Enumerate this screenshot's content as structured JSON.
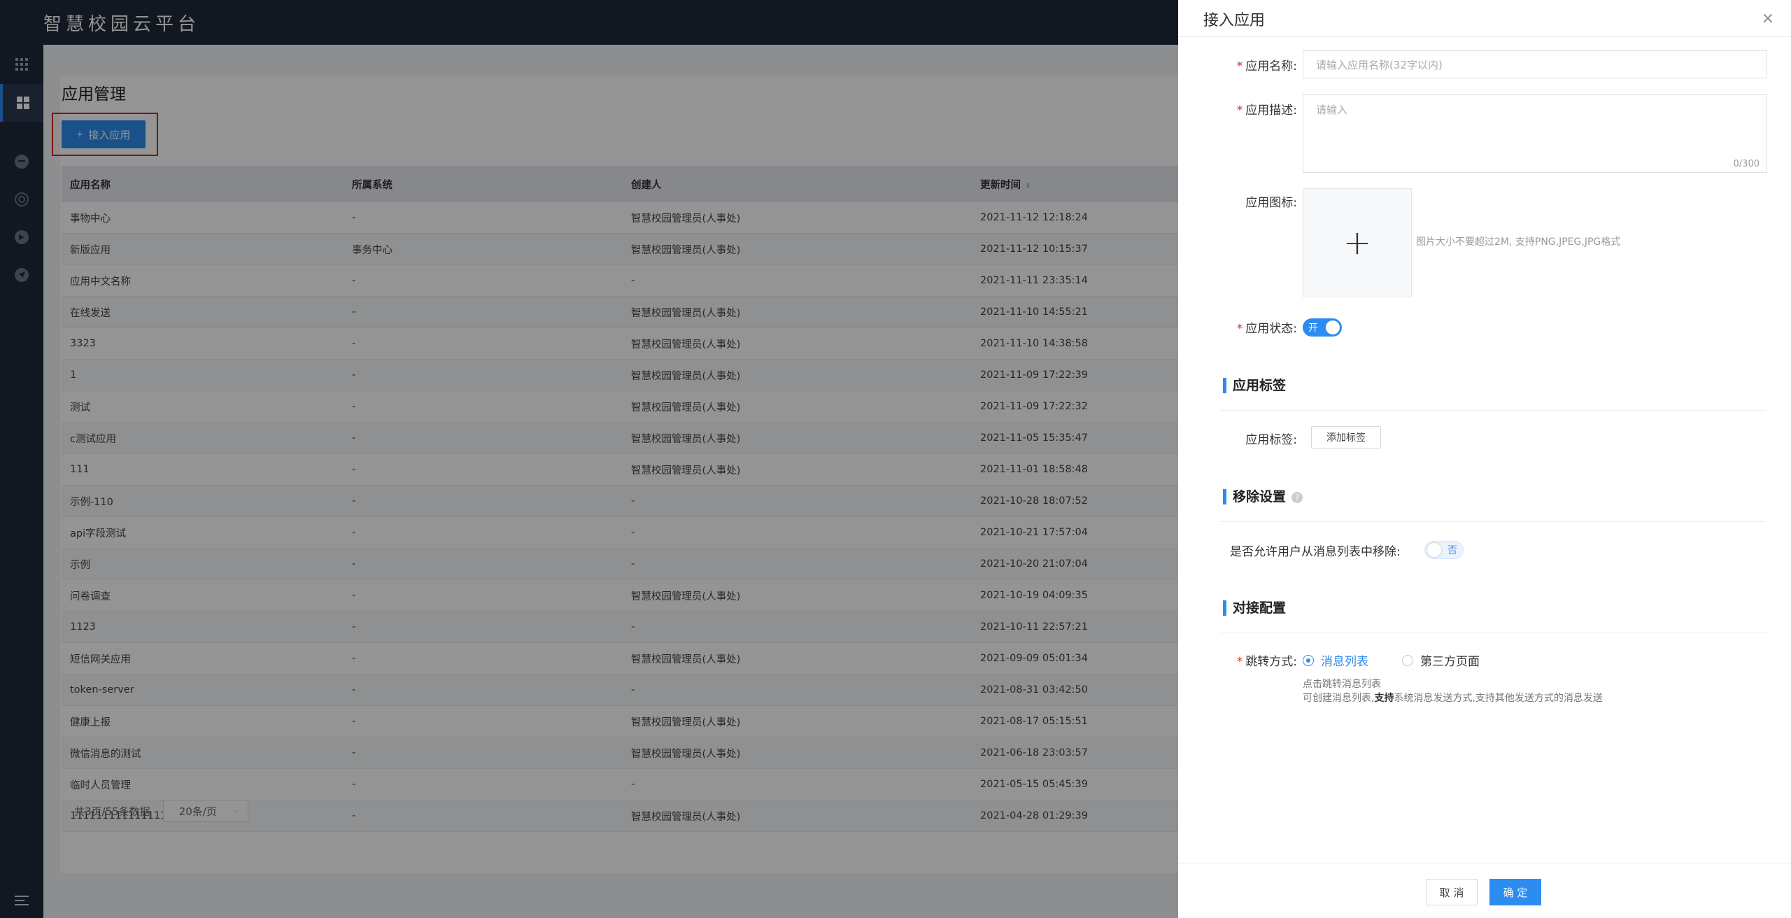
{
  "app": {
    "title": "智慧校园云平台"
  },
  "page": {
    "title": "应用管理",
    "add_button": "接入应用"
  },
  "table": {
    "columns": [
      "应用名称",
      "所属系统",
      "创建人",
      "更新时间"
    ],
    "rows": [
      [
        "事物中心",
        "-",
        "智慧校园管理员(人事处)",
        "2021-11-12 12:18:24"
      ],
      [
        "新版应用",
        "事务中心",
        "智慧校园管理员(人事处)",
        "2021-11-12 10:15:37"
      ],
      [
        "应用中文名称",
        "-",
        "-",
        "2021-11-11 23:35:14"
      ],
      [
        "在线发送",
        "-",
        "智慧校园管理员(人事处)",
        "2021-11-10 14:55:21"
      ],
      [
        "3323",
        "-",
        "智慧校园管理员(人事处)",
        "2021-11-10 14:38:58"
      ],
      [
        "1",
        "-",
        "智慧校园管理员(人事处)",
        "2021-11-09 17:22:39"
      ],
      [
        "测试",
        "-",
        "智慧校园管理员(人事处)",
        "2021-11-09 17:22:32"
      ],
      [
        "c测试应用",
        "-",
        "智慧校园管理员(人事处)",
        "2021-11-05 15:35:47"
      ],
      [
        "111",
        "-",
        "智慧校园管理员(人事处)",
        "2021-11-01 18:58:48"
      ],
      [
        "示例-110",
        "-",
        "-",
        "2021-10-28 18:07:52"
      ],
      [
        "api字段测试",
        "-",
        "-",
        "2021-10-21 17:57:04"
      ],
      [
        "示例",
        "-",
        "-",
        "2021-10-20 21:07:04"
      ],
      [
        "问卷调查",
        "-",
        "智慧校园管理员(人事处)",
        "2021-10-19 04:09:35"
      ],
      [
        "1123",
        "-",
        "-",
        "2021-10-11 22:57:21"
      ],
      [
        "短信网关应用",
        "-",
        "智慧校园管理员(人事处)",
        "2021-09-09 05:01:34"
      ],
      [
        "token-server",
        "-",
        "-",
        "2021-08-31 03:42:50"
      ],
      [
        "健康上报",
        "-",
        "智慧校园管理员(人事处)",
        "2021-08-17 05:15:51"
      ],
      [
        "微信消息的测试",
        "-",
        "智慧校园管理员(人事处)",
        "2021-06-18 23:03:57"
      ],
      [
        "临时人员管理",
        "-",
        "-",
        "2021-05-15 05:45:39"
      ],
      [
        "111111111111111222",
        "-",
        "智慧校园管理员(人事处)",
        "2021-04-28 01:29:39"
      ]
    ]
  },
  "pager": {
    "summary": "共3页/55条数据",
    "page_size": "20条/页"
  },
  "drawer": {
    "title": "接入应用",
    "name_label": "应用名称:",
    "name_placeholder": "请输入应用名称(32字以内)",
    "desc_label": "应用描述:",
    "desc_placeholder": "请输入",
    "desc_counter": "0/300",
    "icon_label": "应用图标:",
    "icon_hint": "图片大小不要超过2M, 支持PNG,JPEG,JPG格式",
    "status_label": "应用状态:",
    "status_on_text": "开",
    "tags_section": "应用标签",
    "tags_label": "应用标签:",
    "add_tag_button": "添加标签",
    "remove_section": "移除设置",
    "remove_label": "是否允许用户从消息列表中移除:",
    "remove_off_text": "否",
    "docking_section": "对接配置",
    "jump_label": "跳转方式:",
    "jump_options": [
      "消息列表",
      "第三方页面"
    ],
    "note_line1": "点击跳转消息列表",
    "note_line2_a": "可创建消息列表,",
    "note_line2_b": "支持",
    "note_line2_c": "系统消息发送方式,支持其他发送方式的消息发送",
    "cancel_button": "取 消",
    "confirm_button": "确 定"
  },
  "colors": {
    "accent": "#2d8cf0",
    "topbar": "#1f2a3b",
    "required": "#e02020"
  }
}
